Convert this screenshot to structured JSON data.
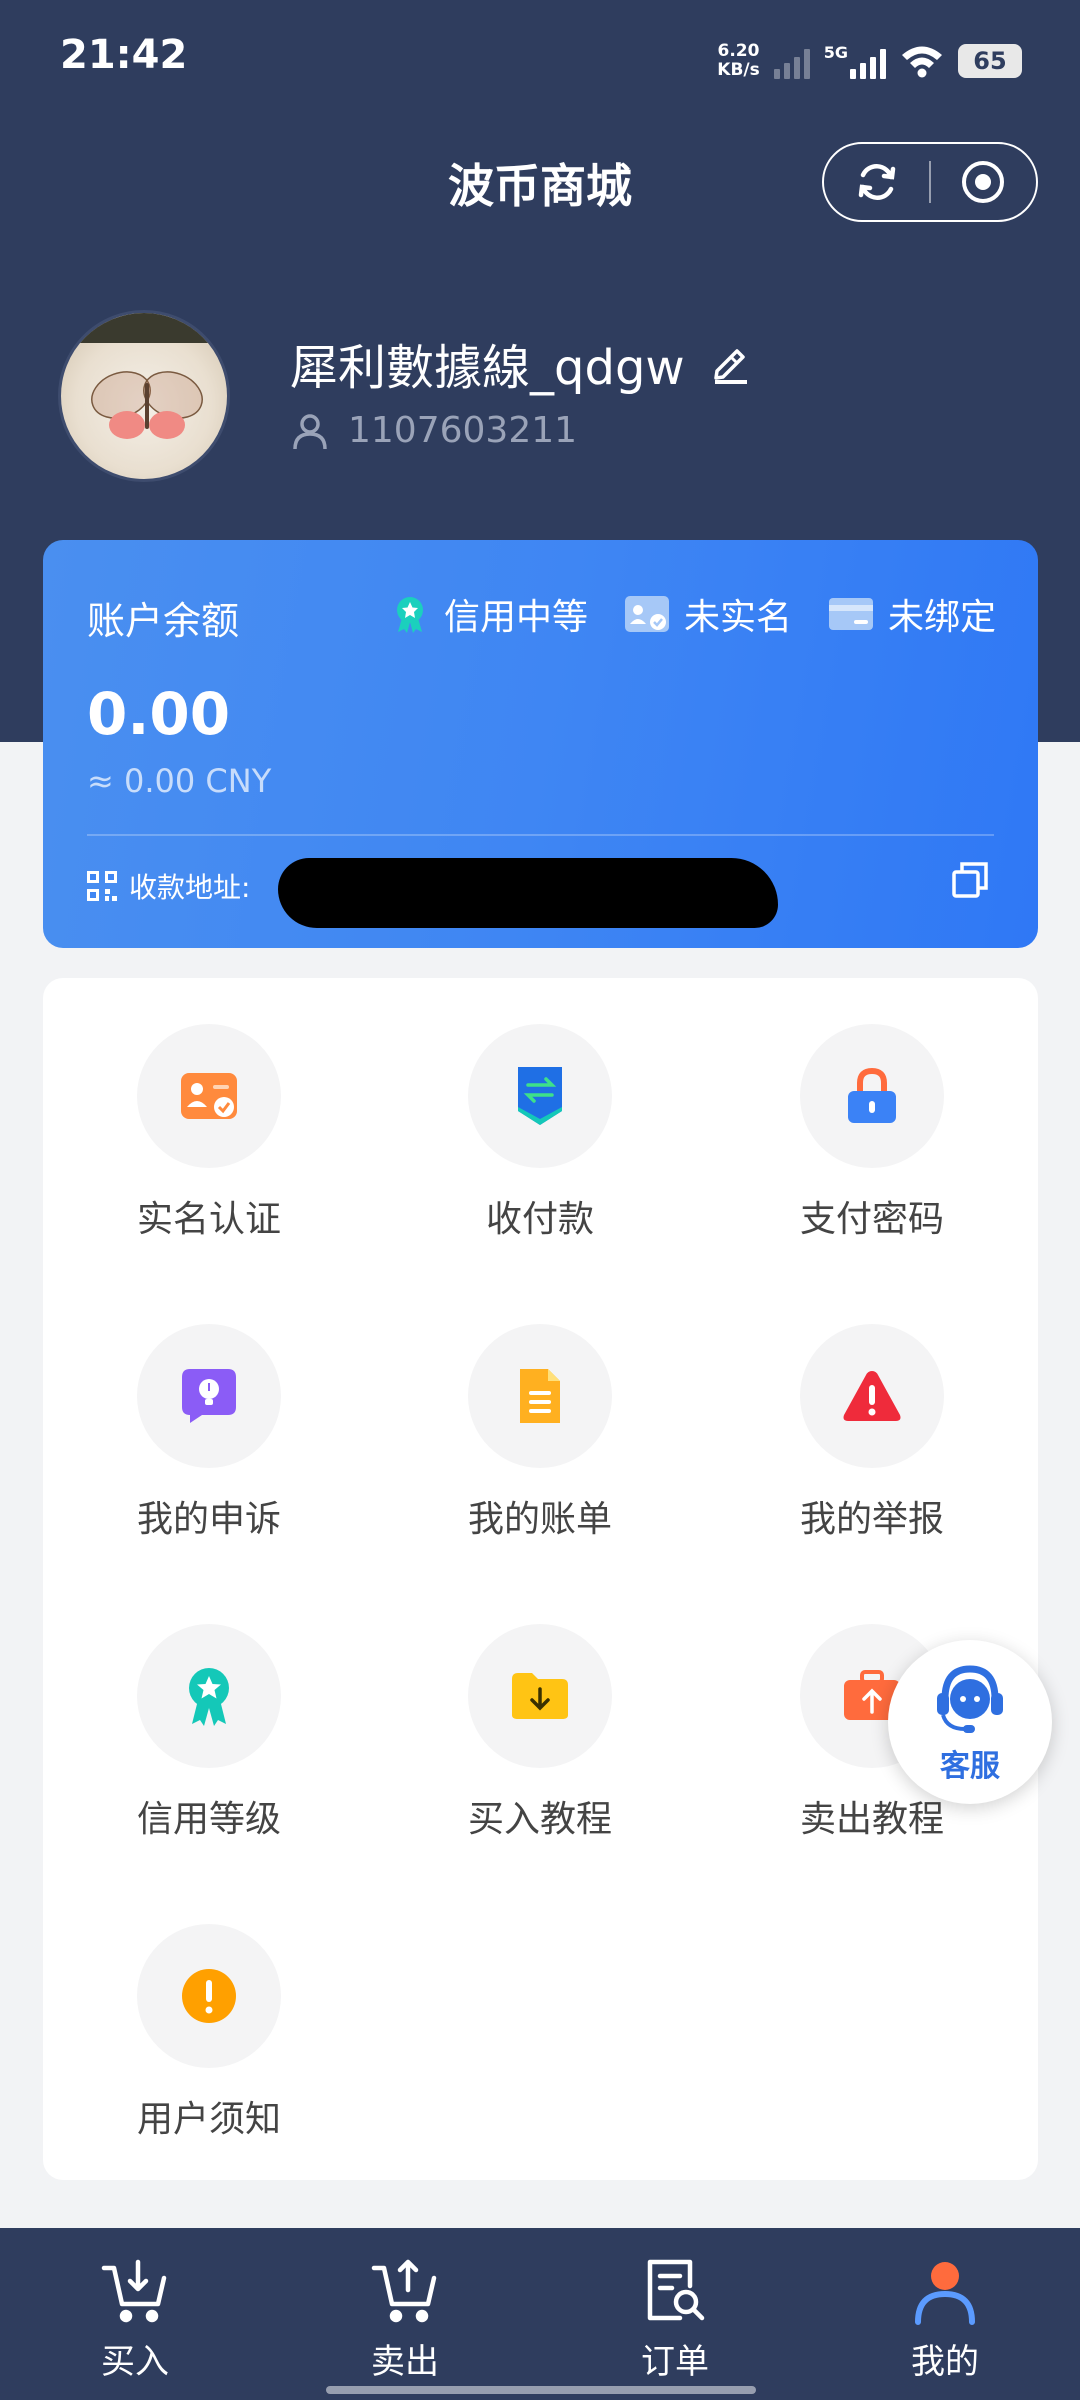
{
  "status_bar": {
    "time": "21:42",
    "net_speed_value": "6.20",
    "net_speed_unit": "KB/s",
    "network": "5G",
    "battery": "65"
  },
  "header": {
    "title": "波币商城"
  },
  "profile": {
    "username": "犀利數據線_qdgw",
    "user_id": "1107603211"
  },
  "balance_card": {
    "label": "账户余额",
    "badges": [
      {
        "label": "信用中等",
        "icon": "medal-icon"
      },
      {
        "label": "未实名",
        "icon": "id-card-icon"
      },
      {
        "label": "未绑定",
        "icon": "bank-card-icon"
      }
    ],
    "amount": "0.00",
    "cny": "≈ 0.00 CNY",
    "address_label": "收款地址:"
  },
  "menu": [
    {
      "label": "实名认证",
      "icon": "realname-icon",
      "color": "#ff8a3d"
    },
    {
      "label": "收付款",
      "icon": "transfer-icon",
      "color": "#1f6fe5"
    },
    {
      "label": "支付密码",
      "icon": "lock-icon",
      "color": "#3b82f6"
    },
    {
      "label": "我的申诉",
      "icon": "appeal-icon",
      "color": "#8b5cf6"
    },
    {
      "label": "我的账单",
      "icon": "bill-icon",
      "color": "#f5a300"
    },
    {
      "label": "我的举报",
      "icon": "warning-icon",
      "color": "#ef2b3b"
    },
    {
      "label": "信用等级",
      "icon": "credit-medal-icon",
      "color": "#14c8b8"
    },
    {
      "label": "买入教程",
      "icon": "buy-guide-icon",
      "color": "#ffc414"
    },
    {
      "label": "卖出教程",
      "icon": "sell-guide-icon",
      "color": "#ff6b3d"
    },
    {
      "label": "用户须知",
      "icon": "notice-icon",
      "color": "#ffa000"
    }
  ],
  "support": {
    "label": "客服"
  },
  "bottom_nav": [
    {
      "label": "买入",
      "icon": "cart-in-icon",
      "active": false
    },
    {
      "label": "卖出",
      "icon": "cart-out-icon",
      "active": false
    },
    {
      "label": "订单",
      "icon": "order-search-icon",
      "active": false
    },
    {
      "label": "我的",
      "icon": "profile-icon",
      "active": true
    }
  ]
}
